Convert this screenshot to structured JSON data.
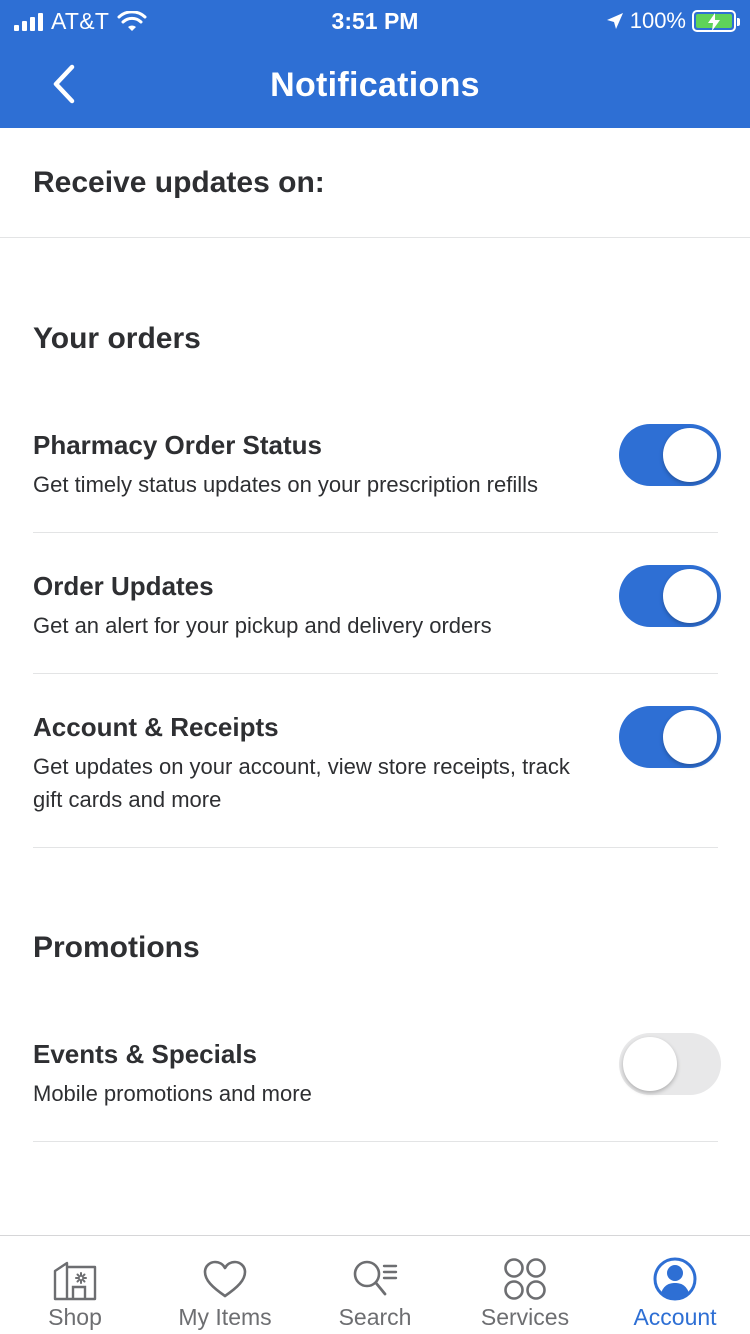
{
  "status_bar": {
    "carrier": "AT&T",
    "time": "3:51 PM",
    "battery": "100%"
  },
  "header": {
    "title": "Notifications"
  },
  "receive": {
    "label": "Receive updates on:"
  },
  "sections": {
    "orders": {
      "title": "Your orders",
      "items": [
        {
          "name": "Pharmacy Order Status",
          "desc": "Get timely status updates on your prescription refills",
          "enabled": true
        },
        {
          "name": "Order Updates",
          "desc": "Get an alert for your pickup and delivery orders",
          "enabled": true
        },
        {
          "name": "Account & Receipts",
          "desc": "Get updates on your account, view store receipts, track gift cards and more",
          "enabled": true
        }
      ]
    },
    "promotions": {
      "title": "Promotions",
      "items": [
        {
          "name": "Events & Specials",
          "desc": "Mobile promotions and more",
          "enabled": false
        }
      ]
    }
  },
  "tabbar": {
    "items": [
      {
        "label": "Shop",
        "icon": "shop-icon",
        "active": false
      },
      {
        "label": "My Items",
        "icon": "heart-icon",
        "active": false
      },
      {
        "label": "Search",
        "icon": "search-icon",
        "active": false
      },
      {
        "label": "Services",
        "icon": "services-icon",
        "active": false
      },
      {
        "label": "Account",
        "icon": "account-icon",
        "active": true
      }
    ]
  },
  "colors": {
    "brand_blue": "#2e6fd4",
    "toggle_off": "#e8e8e9",
    "text": "#2e2f32",
    "tab_inactive": "#6d6e71"
  }
}
